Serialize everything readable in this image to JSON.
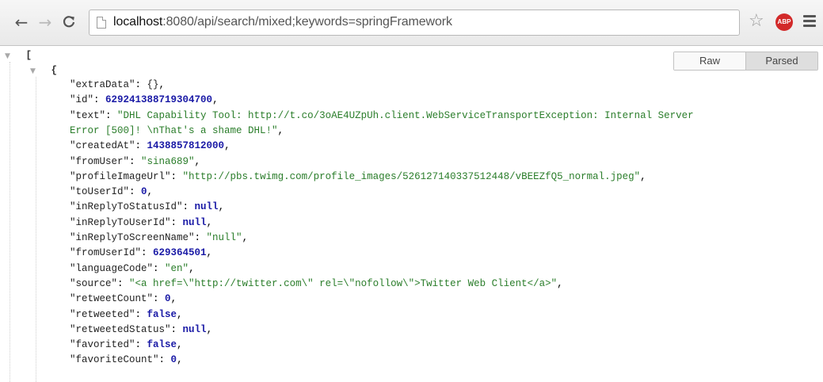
{
  "browser": {
    "url_host": "localhost",
    "url_path": ":8080/api/search/mixed;keywords=springFramework",
    "icons": {
      "back": "←",
      "forward": "→",
      "reload": "C",
      "star": "☆",
      "adblock": "ABP"
    }
  },
  "viewer": {
    "raw_label": "Raw",
    "parsed_label": "Parsed",
    "array_open": "[",
    "object_open": "{",
    "expand_glyph": "▼"
  },
  "json_lines": [
    {
      "key": "\"extraData\"",
      "value": "{}",
      "type": "p"
    },
    {
      "key": "\"id\"",
      "value": "629241388719304700",
      "type": "n"
    },
    {
      "key": "\"text\"",
      "value": "\"DHL Capability Tool: http://t.co/3oAE4UZpUh.client.WebServiceTransportException: Internal Server",
      "type": "s"
    },
    {
      "key": "",
      "value": "Error [500]! \\nThat's a shame DHL!\"",
      "type": "s",
      "continuation": true
    },
    {
      "key": "\"createdAt\"",
      "value": "1438857812000",
      "type": "n"
    },
    {
      "key": "\"fromUser\"",
      "value": "\"sina689\"",
      "type": "s"
    },
    {
      "key": "\"profileImageUrl\"",
      "value": "\"http://pbs.twimg.com/profile_images/526127140337512448/vBEEZfQ5_normal.jpeg\"",
      "type": "s"
    },
    {
      "key": "\"toUserId\"",
      "value": "0",
      "type": "n"
    },
    {
      "key": "\"inReplyToStatusId\"",
      "value": "null",
      "type": "lit"
    },
    {
      "key": "\"inReplyToUserId\"",
      "value": "null",
      "type": "lit"
    },
    {
      "key": "\"inReplyToScreenName\"",
      "value": "\"null\"",
      "type": "s"
    },
    {
      "key": "\"fromUserId\"",
      "value": "629364501",
      "type": "n"
    },
    {
      "key": "\"languageCode\"",
      "value": "\"en\"",
      "type": "s"
    },
    {
      "key": "\"source\"",
      "value": "\"<a href=\\\"http://twitter.com\\\" rel=\\\"nofollow\\\">Twitter Web Client</a>\"",
      "type": "s"
    },
    {
      "key": "\"retweetCount\"",
      "value": "0",
      "type": "n"
    },
    {
      "key": "\"retweeted\"",
      "value": "false",
      "type": "lit"
    },
    {
      "key": "\"retweetedStatus\"",
      "value": "null",
      "type": "lit"
    },
    {
      "key": "\"favorited\"",
      "value": "false",
      "type": "lit"
    },
    {
      "key": "\"favoriteCount\"",
      "value": "0",
      "type": "n"
    }
  ]
}
